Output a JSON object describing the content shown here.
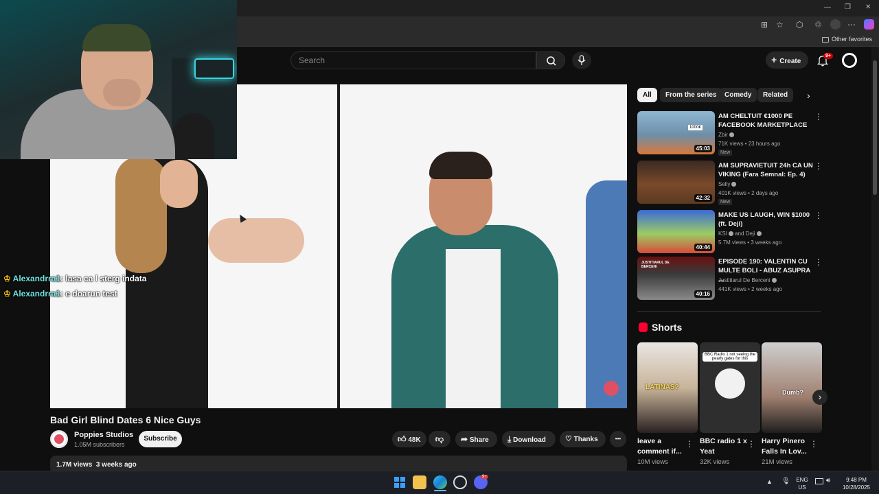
{
  "browser": {
    "other_favorites": "Other favorites",
    "window_controls": [
      "—",
      "❐",
      "✕"
    ]
  },
  "header": {
    "search_placeholder": "Search",
    "create_label": "Create",
    "notification_count": "9+"
  },
  "chat_overlay": [
    {
      "user": "Alexandrra1",
      "message": ": lasa ca l sterg indata"
    },
    {
      "user": "Alexandrra1",
      "message": ": e doarun test"
    }
  ],
  "video": {
    "title": "Bad Girl Blind Dates 6 Nice Guys",
    "channel": "Poppies Studios",
    "subscribers": "1.05M subscribers",
    "subscribe_label": "Subscribe",
    "likes": "48K",
    "share_label": "Share",
    "download_label": "Download",
    "thanks_label": "Thanks",
    "more_label": "•••",
    "views": "1.7M views",
    "age": "3 weeks ago"
  },
  "filter_chips": [
    "All",
    "From the series",
    "Comedy",
    "Related"
  ],
  "recommendations": [
    {
      "title": "AM CHELTUIT €1000 PE FACEBOOK MARKETPLACE",
      "channel": "Zbir",
      "meta": "71K views • 23 hours ago",
      "badge": "New",
      "duration": "45:03",
      "thumb_text": "1000€"
    },
    {
      "title": "AM SUPRAVIETUIT 24h CA UN VIKING (Fara Semnal: Ep. 4)",
      "channel": "Selly",
      "meta": "401K views • 2 days ago",
      "badge": "New",
      "duration": "42:32",
      "thumb_text": ""
    },
    {
      "title": "MAKE US LAUGH, WIN $1000 (ft. Deji)",
      "channel": "KSI",
      "channel_extra": "and Deji",
      "meta": "5.7M views • 3 weeks ago",
      "badge": "",
      "duration": "40:44",
      "thumb_text": ""
    },
    {
      "title": "EPISODE 190: VALENTIN CU MULTE BOLI - ABUZ ASUPRA ...",
      "channel": "Justitiarul De Berceni",
      "meta": "441K views • 2 weeks ago",
      "badge": "",
      "duration": "40:16",
      "thumb_text": "JUSTITIARUL DE BERCENI"
    }
  ],
  "shorts": {
    "heading": "Shorts",
    "items": [
      {
        "title": "leave a comment if...",
        "views": "10M views",
        "thumb_text": "LATINAS?"
      },
      {
        "title": "BBC radio 1 x Yeat",
        "views": "32K views",
        "thumb_text": "BBC Radio 1 not seeing the pearly gates for this"
      },
      {
        "title": "Harry Pinero Falls In Lov...",
        "views": "21M views",
        "thumb_text": "Dumb?"
      }
    ]
  },
  "taskbar": {
    "lang": "ENG",
    "region": "US",
    "time": "9:48 PM",
    "date": "10/28/2025",
    "discord_badge": "9+"
  }
}
